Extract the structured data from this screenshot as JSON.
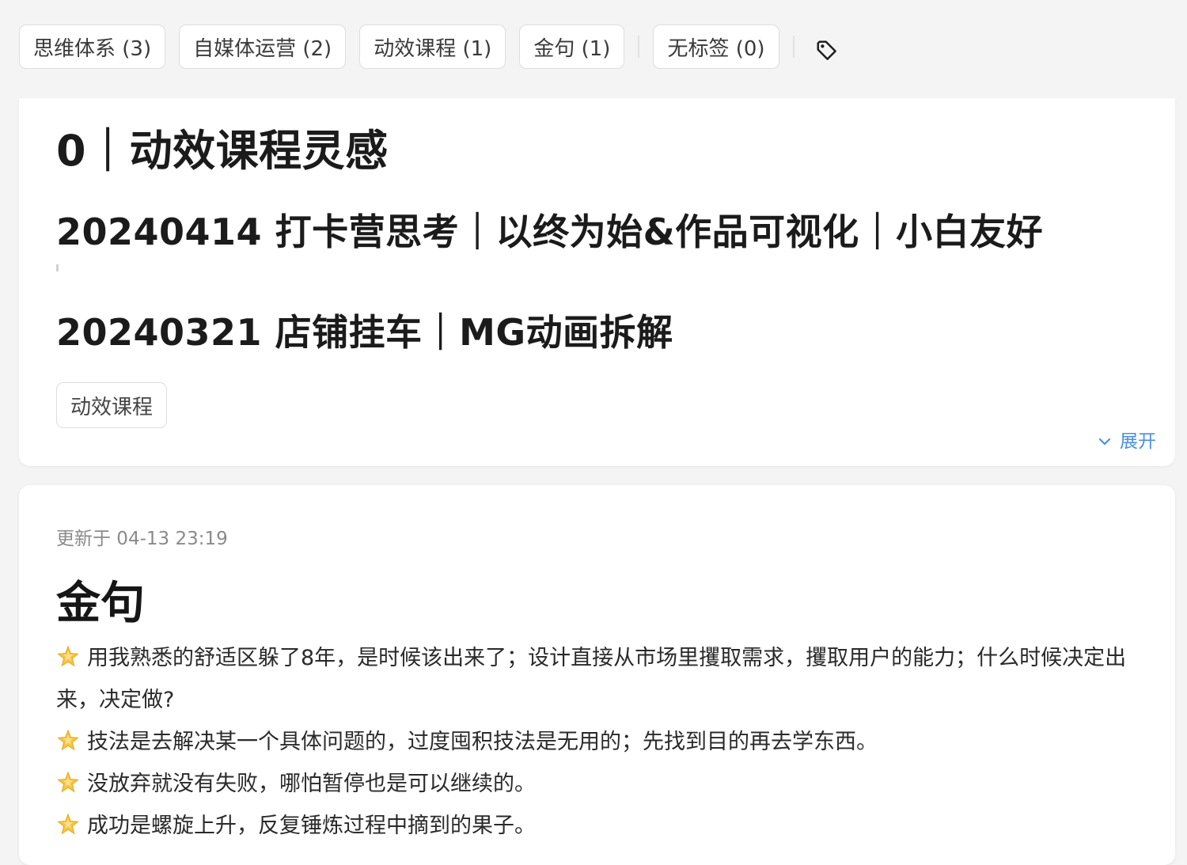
{
  "tag_filter": {
    "tags": [
      {
        "label": "思维体系 (3)"
      },
      {
        "label": "自媒体运营 (2)"
      },
      {
        "label": "动效课程 (1)"
      },
      {
        "label": "金句 (1)"
      }
    ],
    "untagged": {
      "label": "无标签 (0)"
    },
    "tag_icon": "tag-icon"
  },
  "card1": {
    "heading1": "0｜动效课程灵感",
    "heading2": "20240414 打卡营思考｜以终为始&作品可视化｜小白友好",
    "heading3": "20240321 店铺挂车｜MG动画拆解",
    "tag": "动效课程",
    "expand_label": "展开",
    "expand_icon": "chevron-down-icon"
  },
  "card2": {
    "updated": "更新于 04-13 23:19",
    "title": "金句",
    "bullet_icon": "star-emoji-icon",
    "quotes": [
      "用我熟悉的舒适区躲了8年，是时候该出来了；设计直接从市场里攫取需求，攫取用户的能力；什么时候决定出来，决定做?",
      "技法是去解决某一个具体问题的，过度囤积技法是无用的；先找到目的再去学东西。",
      "没放弃就没有失败，哪怕暂停也是可以继续的。",
      "成功是螺旋上升，反复锤炼过程中摘到的果子。"
    ]
  },
  "colors": {
    "background": "#f4f4f4",
    "card": "#ffffff",
    "accent_link": "#4a8fe0",
    "muted_text": "#8a8a8a",
    "star": "#f6c343"
  }
}
